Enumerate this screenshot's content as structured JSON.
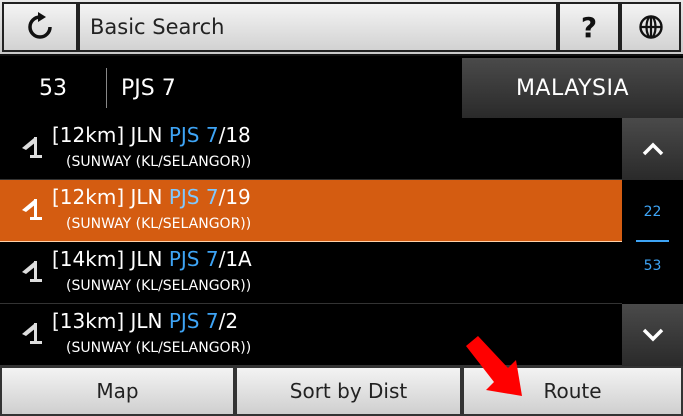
{
  "header": {
    "title": "Basic Search",
    "reset_icon": "refresh-icon",
    "help_label": "?",
    "language_icon": "globe-icon"
  },
  "search": {
    "result_count": "53",
    "query": "PJS 7",
    "country": "MALAYSIA"
  },
  "results": [
    {
      "prefix": "[12km] JLN ",
      "match": "PJS 7",
      "suffix": "/18",
      "area": "(SUNWAY (KL/SELANGOR))",
      "selected": false,
      "icon": "road-sign-icon"
    },
    {
      "prefix": "[12km] JLN ",
      "match": "PJS 7",
      "suffix": "/19",
      "area": "(SUNWAY (KL/SELANGOR))",
      "selected": true,
      "icon": "road-sign-icon"
    },
    {
      "prefix": "[14km] JLN ",
      "match": "PJS 7",
      "suffix": "/1A",
      "area": "(SUNWAY (KL/SELANGOR))",
      "selected": false,
      "icon": "road-sign-icon"
    },
    {
      "prefix": "[13km] JLN ",
      "match": "PJS 7",
      "suffix": "/2",
      "area": "(SUNWAY (KL/SELANGOR))",
      "selected": false,
      "icon": "road-sign-icon"
    }
  ],
  "scrollbar": {
    "up_icon": "chevron-up-icon",
    "down_icon": "chevron-down-icon",
    "current": "22",
    "total": "53"
  },
  "footer": {
    "map_label": "Map",
    "sort_label": "Sort by Dist",
    "route_label": "Route"
  },
  "colors": {
    "highlight_text": "#3ea4f5",
    "selected_row": "#d45c11",
    "pointer_arrow": "#ff0000"
  }
}
